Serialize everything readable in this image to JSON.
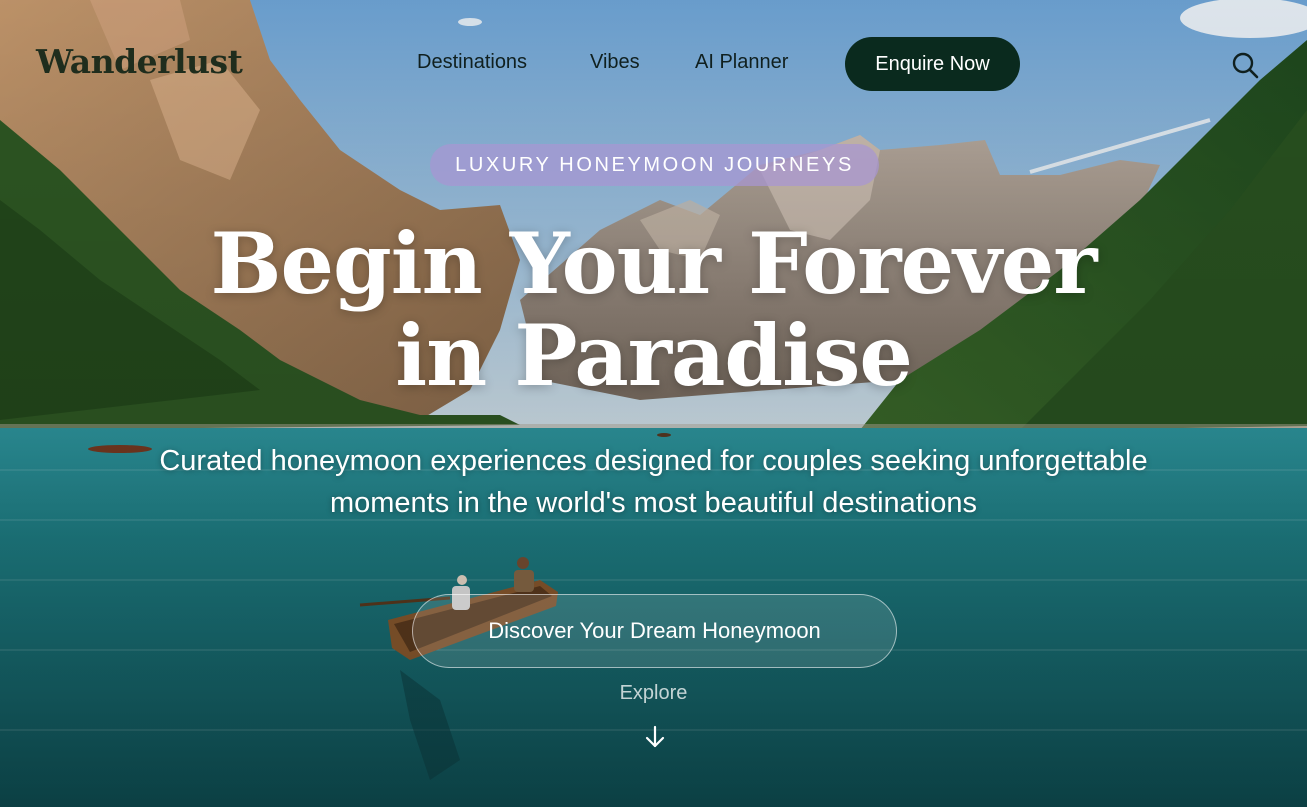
{
  "brand": {
    "logo_text": "Wanderlust"
  },
  "nav": {
    "items": [
      {
        "label": "Destinations"
      },
      {
        "label": "Vibes"
      },
      {
        "label": "AI Planner"
      }
    ],
    "cta_label": "Enquire Now",
    "search_icon": "search-icon"
  },
  "hero": {
    "badge": "LUXURY HONEYMOON JOURNEYS",
    "headline_line1": "Begin Your Forever",
    "headline_line2": "in Paradise",
    "subtitle": "Curated honeymoon experiences designed for couples seeking unforgettable moments in the world's most beautiful destinations",
    "cta_label": "Discover Your Dream Honeymoon",
    "explore_label": "Explore",
    "explore_icon": "arrow-down-icon"
  },
  "colors": {
    "enquire_bg": "#0a2a1e",
    "badge_bg": "#a896d2",
    "text_dark": "#10201f",
    "text_light": "#ffffff"
  }
}
